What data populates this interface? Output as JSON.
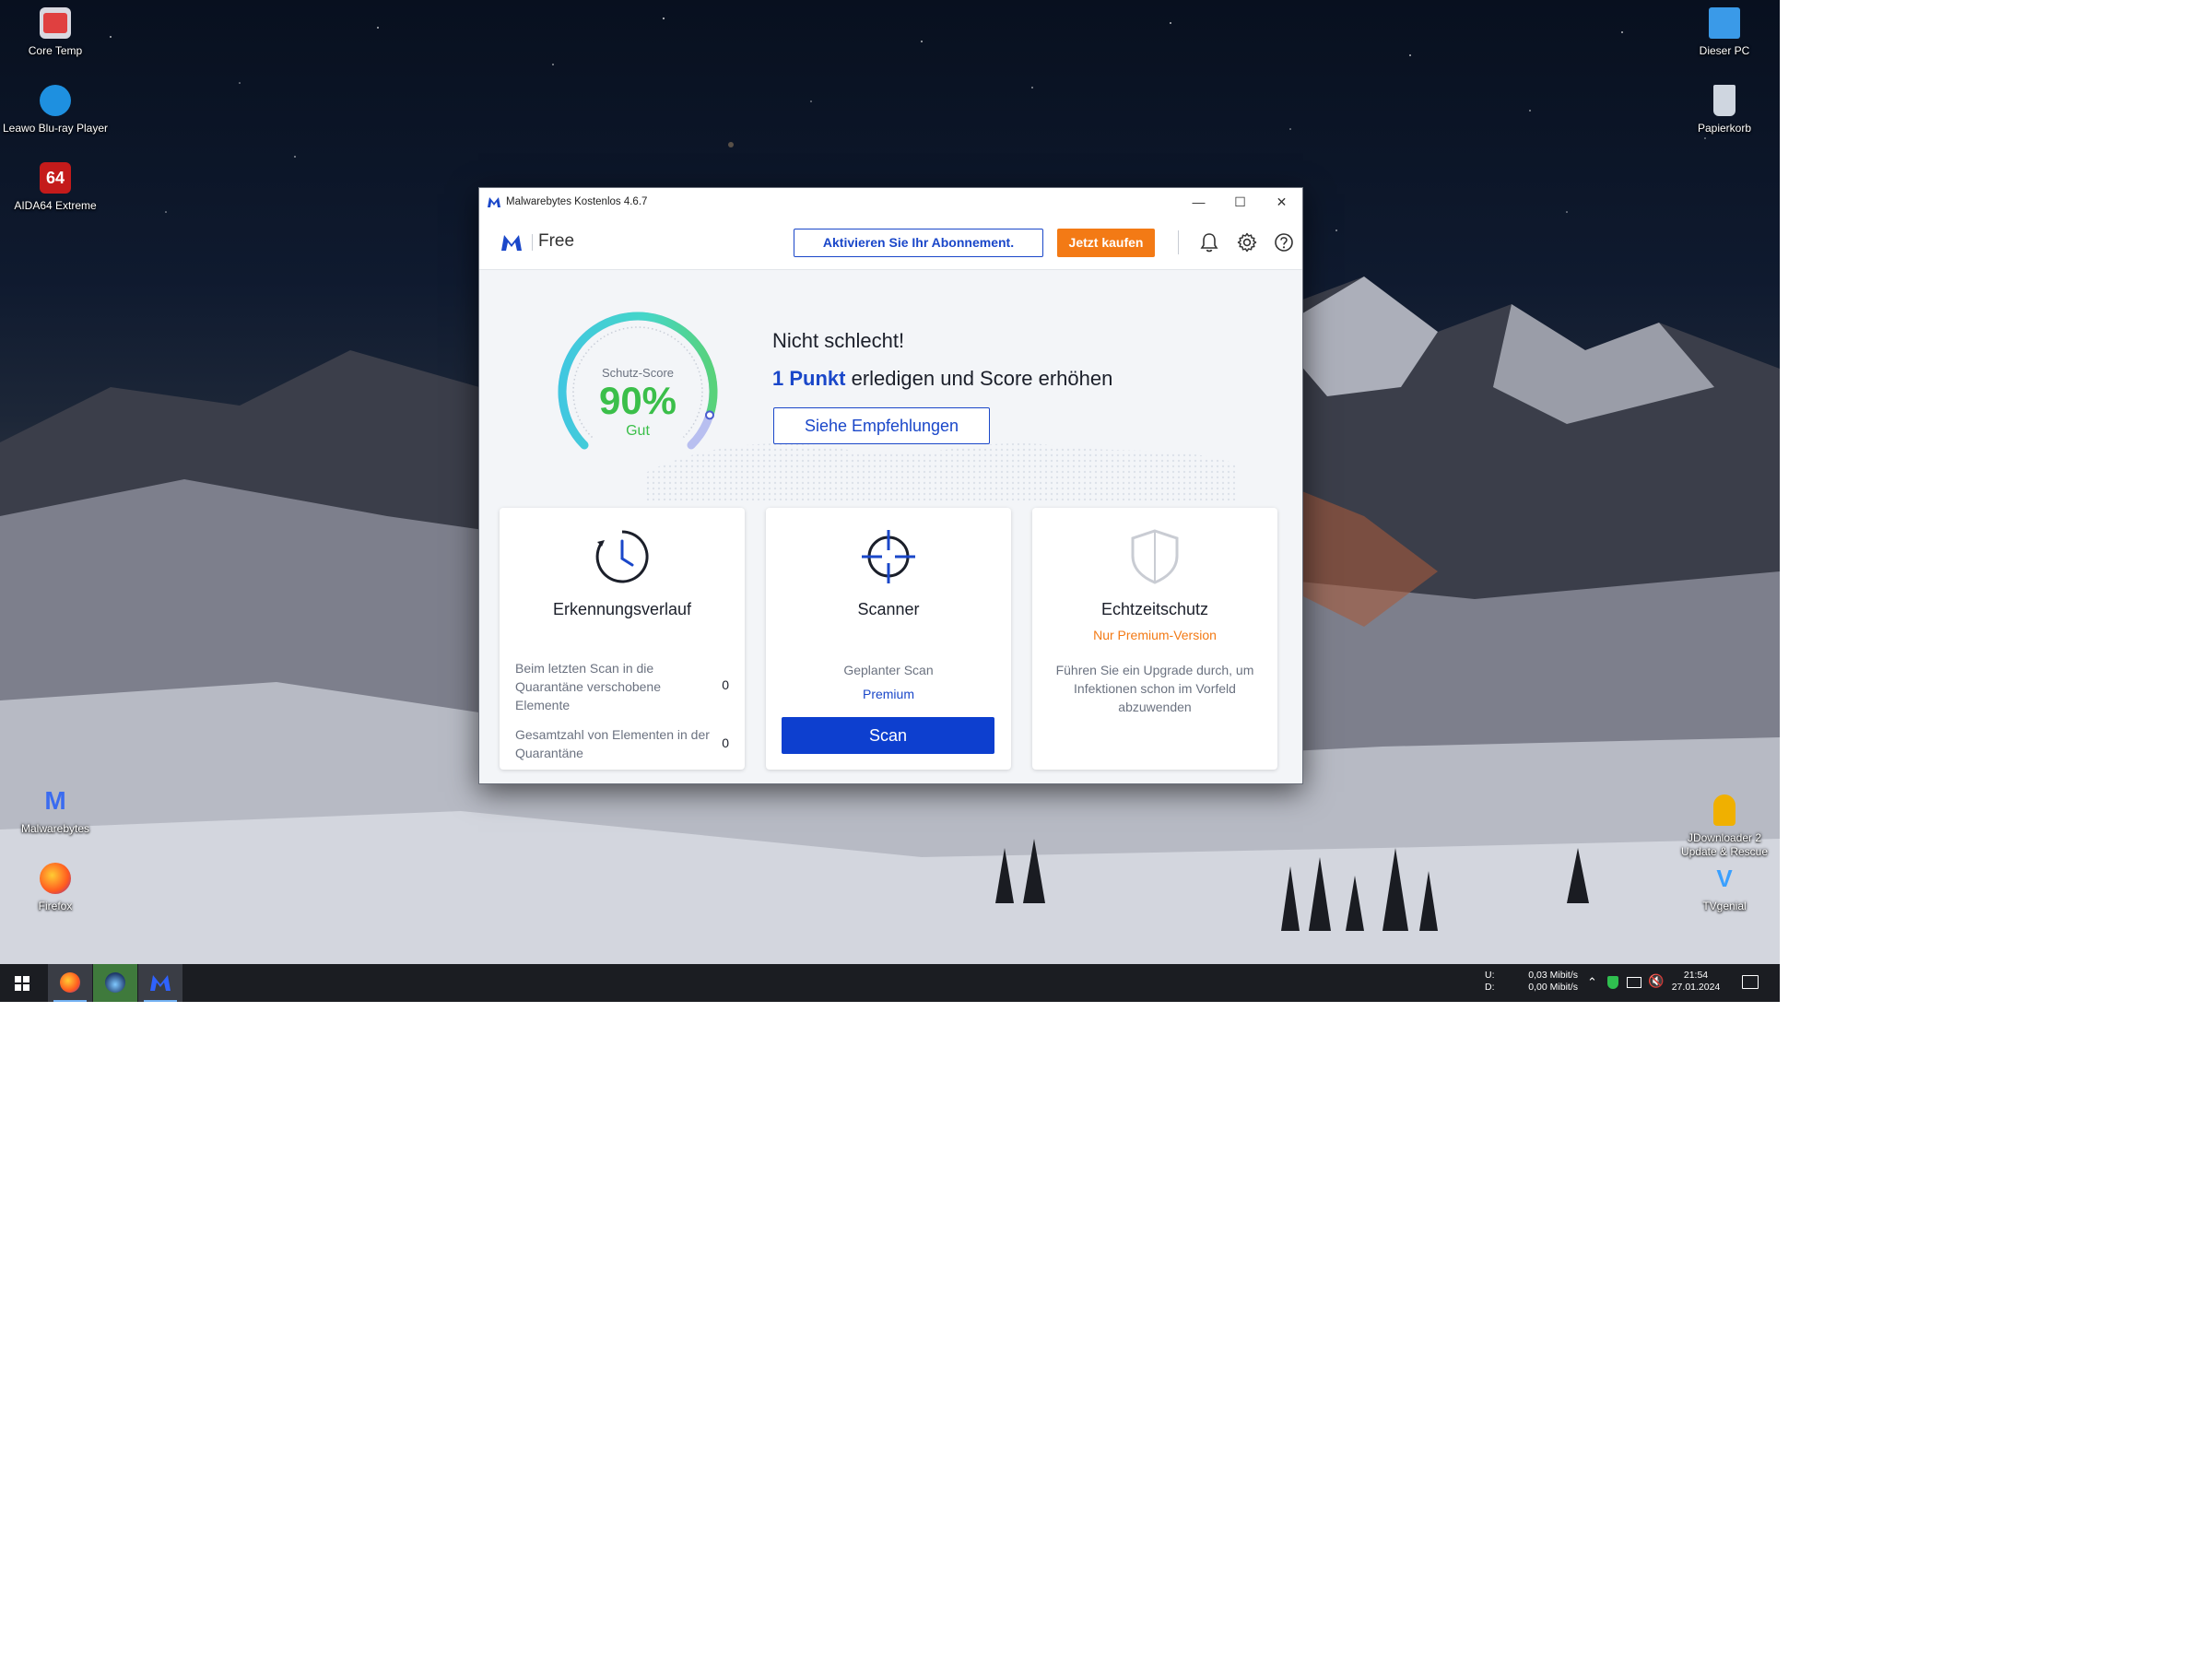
{
  "desktop": {
    "left_icons": [
      {
        "label": "Core Temp",
        "icon": "core-temp-icon"
      },
      {
        "label": "Leawo Blu-ray Player",
        "icon": "leawo-icon"
      },
      {
        "label": "AIDA64 Extreme",
        "icon": "aida64-icon"
      },
      {
        "label": "Malwarebytes",
        "icon": "malwarebytes-icon"
      },
      {
        "label": "Firefox",
        "icon": "firefox-icon"
      }
    ],
    "right_icons": [
      {
        "label": "Dieser PC",
        "icon": "this-pc-icon"
      },
      {
        "label": "Papierkorb",
        "icon": "recycle-bin-icon"
      },
      {
        "label": "JDownloader 2 Update & Rescue",
        "icon": "jdownloader-icon"
      },
      {
        "label": "TVgenial",
        "icon": "tvgenial-icon"
      }
    ]
  },
  "window": {
    "title": "Malwarebytes Kostenlos 4.6.7",
    "edition": "Free",
    "activate_label": "Aktivieren Sie Ihr Abonnement.",
    "buy_label": "Jetzt kaufen"
  },
  "score": {
    "caption": "Schutz-Score",
    "value_text": "90%",
    "value": 90,
    "rating": "Gut",
    "headline": "Nicht schlecht!",
    "points": "1 Punkt",
    "points_rest": "erledigen und Score erhöhen",
    "recommend_label": "Siehe Empfehlungen"
  },
  "cards": {
    "history": {
      "title": "Erkennungsverlauf",
      "row1_label": "Beim letzten Scan in die Quarantäne verschobene Elemente",
      "row1_value": "0",
      "row2_label": "Gesamtzahl von Elementen in der Quarantäne",
      "row2_value": "0"
    },
    "scanner": {
      "title": "Scanner",
      "scheduled": "Geplanter Scan",
      "premium": "Premium",
      "scan_label": "Scan"
    },
    "realtime": {
      "title": "Echtzeitschutz",
      "premium_only": "Nur Premium-Version",
      "description": "Führen Sie ein Upgrade durch, um Infektionen schon im Vorfeld abzuwenden"
    }
  },
  "taskbar": {
    "net_up_label": "U:",
    "net_down_label": "D:",
    "net_up": "0,03 Mibit/s",
    "net_down": "0,00 Mibit/s",
    "time": "21:54",
    "date": "27.01.2024"
  },
  "colors": {
    "accent_blue": "#1a47c9",
    "orange": "#f37a15",
    "score_green": "#3bbf4a",
    "gauge_teal": "#41d3d6"
  }
}
